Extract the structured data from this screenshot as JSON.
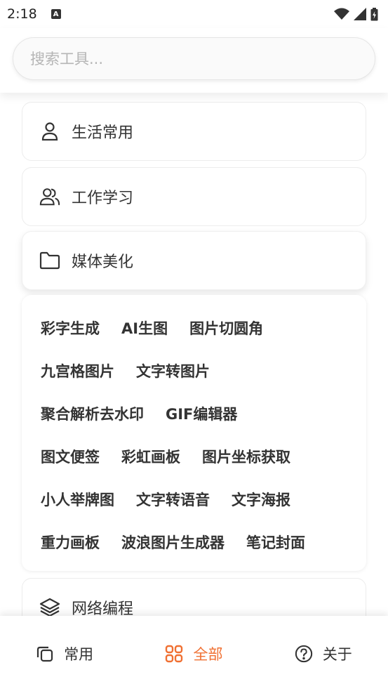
{
  "status_bar": {
    "time": "2:18",
    "notif_letter": "A"
  },
  "search": {
    "placeholder": "搜索工具..."
  },
  "categories": [
    {
      "label": "生活常用",
      "icon": "person-icon"
    },
    {
      "label": "工作学习",
      "icon": "people-icon"
    },
    {
      "label": "媒体美化",
      "icon": "folder-icon"
    },
    {
      "label": "网络编程",
      "icon": "layers-icon"
    }
  ],
  "tools": [
    [
      "彩字生成",
      "AI生图",
      "图片切圆角"
    ],
    [
      "九宫格图片",
      "文字转图片"
    ],
    [
      "聚合解析去水印",
      "GIF编辑器"
    ],
    [
      "图文便签",
      "彩虹画板",
      "图片坐标获取"
    ],
    [
      "小人举牌图",
      "文字转语音",
      "文字海报"
    ],
    [
      "重力画板",
      "波浪图片生成器",
      "笔记封面"
    ]
  ],
  "bottom_nav": [
    {
      "label": "常用",
      "icon": "copy-icon"
    },
    {
      "label": "全部",
      "icon": "grid-icon",
      "active": true
    },
    {
      "label": "关于",
      "icon": "help-icon"
    }
  ],
  "accent_color": "#f07032"
}
